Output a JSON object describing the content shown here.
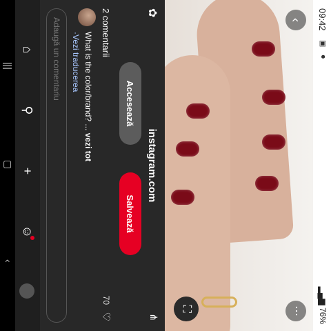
{
  "status": {
    "time": "09:42",
    "battery": "76%"
  },
  "pin": {
    "source": "instagram.com",
    "visit_label": "Accesează",
    "save_label": "Salvează",
    "comments_count": "2 comentarii",
    "likes": "70",
    "comment_text": "What is the color/brand? ...",
    "comment_more": "vezi tot",
    "translate_label": "·Vezi traducerea",
    "add_comment_placeholder": "Adaugă un comentariu"
  },
  "icons": {
    "back": "chevron-left-icon",
    "more": "more-icon",
    "lens": "visual-search-icon",
    "pin": "pin-icon",
    "share": "share-icon",
    "like": "heart-icon"
  },
  "colors": {
    "save": "#e60023",
    "visit": "#5c5c5c",
    "sheet_bg": "#282828",
    "nail": "#7a0b18"
  }
}
